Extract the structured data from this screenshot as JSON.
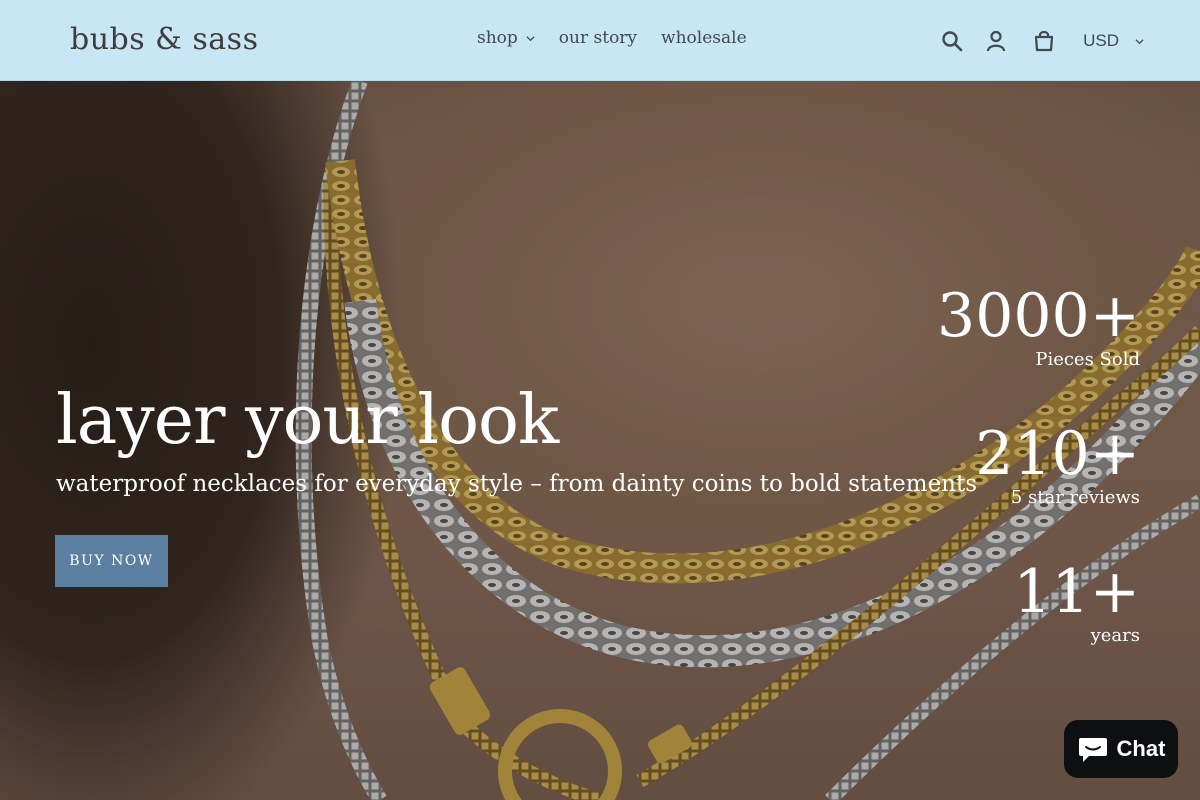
{
  "header": {
    "logo": "bubs & sass",
    "nav": [
      {
        "label": "shop",
        "has_dropdown": true
      },
      {
        "label": "our story",
        "has_dropdown": false
      },
      {
        "label": "wholesale",
        "has_dropdown": false
      }
    ],
    "icons": [
      "search-icon",
      "account-icon",
      "cart-icon"
    ],
    "currency": "USD"
  },
  "hero": {
    "title": "layer your look",
    "subtitle": "waterproof necklaces for everyday style – from dainty coins to bold statements",
    "cta_label": "BUY NOW",
    "stats": [
      {
        "value": "3000+",
        "label": "Pieces Sold"
      },
      {
        "value": "210+",
        "label": "5 star reviews"
      },
      {
        "value": "11+",
        "label": "years"
      }
    ]
  },
  "chat": {
    "label": "Chat"
  },
  "colors": {
    "header_bg": "#c9e6f5",
    "button_bg": "#5a7fa1",
    "text_dark": "#3d4a52",
    "chat_bg": "#0e0f10"
  }
}
